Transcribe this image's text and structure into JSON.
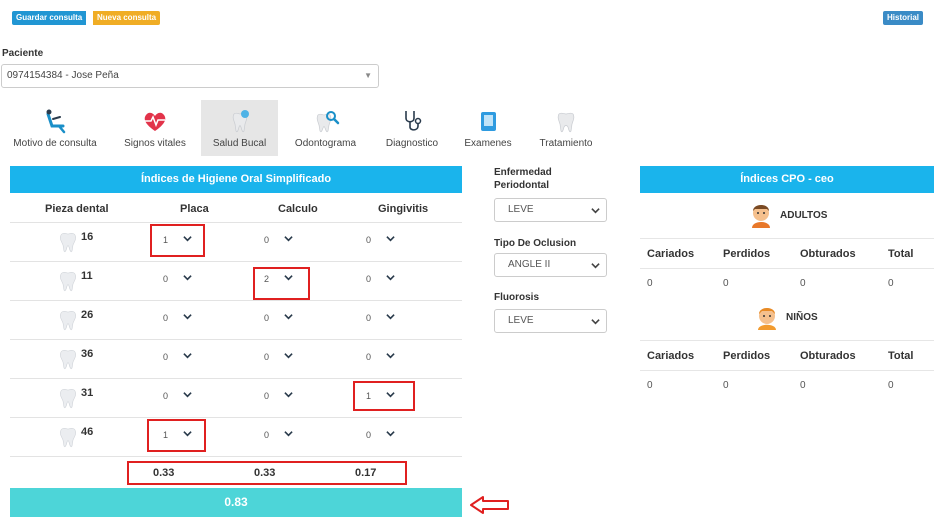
{
  "toolbar": {
    "save_label": "Guardar consulta",
    "new_label": "Nueva consulta",
    "history_label": "Historial"
  },
  "patient": {
    "label": "Paciente",
    "value": "0974154384 - Jose Peña"
  },
  "tabs": [
    {
      "label": "Motivo de consulta",
      "icon": "dental-chair-icon"
    },
    {
      "label": "Signos vitales",
      "icon": "heart-pulse-icon"
    },
    {
      "label": "Salud Bucal",
      "icon": "tooth-sparkle-icon",
      "active": true
    },
    {
      "label": "Odontograma",
      "icon": "tooth-search-icon"
    },
    {
      "label": "Diagnostico",
      "icon": "stethoscope-icon"
    },
    {
      "label": "Examenes",
      "icon": "xray-icon"
    },
    {
      "label": "Tratamiento",
      "icon": "tooth-icon"
    }
  ],
  "ihos": {
    "title": "Índices de Higiene Oral Simplificado",
    "headers": {
      "piece": "Pieza dental",
      "plaque": "Placa",
      "calculus": "Calculo",
      "gingivitis": "Gingivitis"
    },
    "rows": [
      {
        "tooth": "16",
        "plaque": "1",
        "calculus": "0",
        "gingivitis": "0"
      },
      {
        "tooth": "11",
        "plaque": "0",
        "calculus": "2",
        "gingivitis": "0"
      },
      {
        "tooth": "26",
        "plaque": "0",
        "calculus": "0",
        "gingivitis": "0"
      },
      {
        "tooth": "36",
        "plaque": "0",
        "calculus": "0",
        "gingivitis": "0"
      },
      {
        "tooth": "31",
        "plaque": "0",
        "calculus": "0",
        "gingivitis": "1"
      },
      {
        "tooth": "46",
        "plaque": "1",
        "calculus": "0",
        "gingivitis": "0"
      }
    ],
    "totals": {
      "plaque": "0.33",
      "calculus": "0.33",
      "gingivitis": "0.17"
    },
    "result": "0.83"
  },
  "middle": {
    "periodontal_label_1": "Enfermedad",
    "periodontal_label_2": "Periodontal",
    "periodontal_value": "LEVE",
    "occlusion_label": "Tipo De Oclusion",
    "occlusion_value": "ANGLE II",
    "fluorosis_label": "Fluorosis",
    "fluorosis_value": "LEVE"
  },
  "cpo": {
    "title": "Índices CPO - ceo",
    "adults_label": "ADULTOS",
    "children_label": "NIÑOS",
    "headers": [
      "Cariados",
      "Perdidos",
      "Obturados",
      "Total"
    ],
    "adults_values": [
      "0",
      "0",
      "0",
      "0"
    ],
    "children_values": [
      "0",
      "0",
      "0",
      "0"
    ]
  },
  "colors": {
    "header_blue": "#1ab4ec",
    "result_teal": "#4dd5d8",
    "highlight_red": "#e02020"
  }
}
